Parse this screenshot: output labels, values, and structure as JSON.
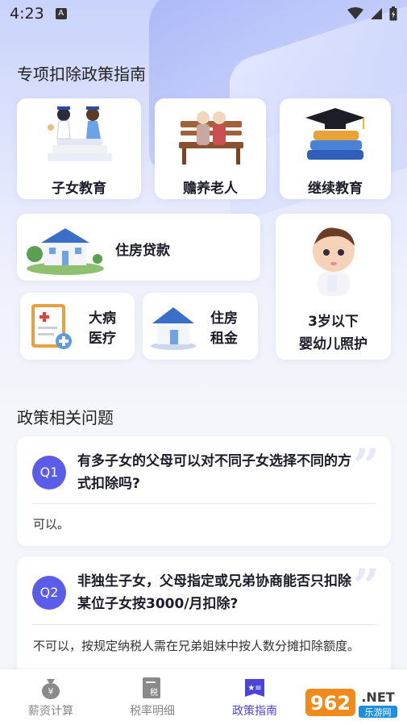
{
  "status_bar": {
    "time": "4:23",
    "a_label": "A"
  },
  "section1": {
    "title": "专项扣除政策指南"
  },
  "cards": {
    "child_education": "子女教育",
    "elderly_support": "赡养老人",
    "continuing_education": "继续教育",
    "housing_loan": "住房贷款",
    "medical_line1": "大病",
    "medical_line2": "医疗",
    "rent_line1": "住房",
    "rent_line2": "租金",
    "infant_line1": "3岁以下",
    "infant_line2": "婴幼儿照护"
  },
  "section2": {
    "title": "政策相关问题"
  },
  "faqs": [
    {
      "badge": "Q1",
      "question": "有多子女的父母可以对不同子女选择不同的方式扣除吗?",
      "answer": "可以。"
    },
    {
      "badge": "Q2",
      "question": "非独生子女，父母指定或兄弟协商能否只扣除某位子女按3000/月扣除?",
      "answer": "不可以，按规定纳税人需在兄弟姐妹中按人数分摊扣除额度。"
    }
  ],
  "tabs": [
    {
      "label": "薪资计算",
      "icon": "salary-calc-icon",
      "active": false
    },
    {
      "label": "税率明细",
      "icon": "tax-rate-icon",
      "active": false
    },
    {
      "label": "政策指南",
      "icon": "policy-guide-icon",
      "active": true
    }
  ],
  "watermark": {
    "text1": "962",
    "text2": ".NET",
    "text3": "乐游网"
  },
  "colors": {
    "accent": "#5b5ce8",
    "active_tab": "#4b44d8"
  }
}
